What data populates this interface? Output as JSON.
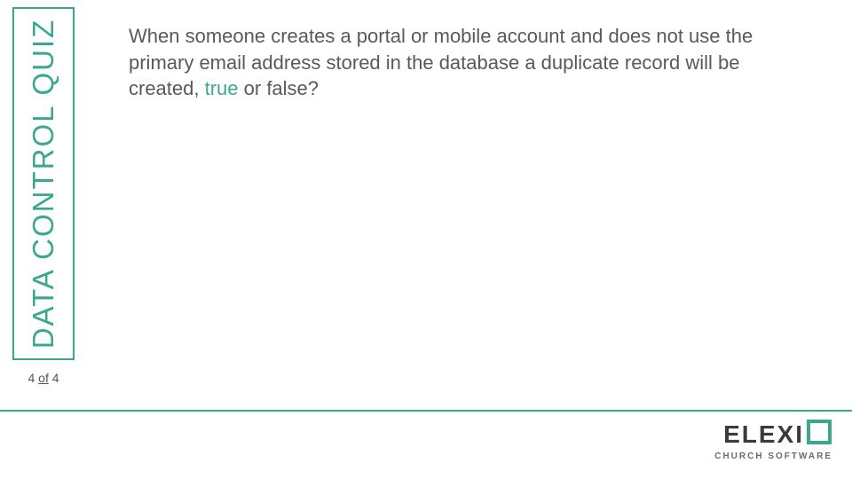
{
  "sidebar": {
    "title": "DATA CONTROL QUIZ"
  },
  "pager": {
    "current": "4",
    "of_word": "of",
    "total": "4"
  },
  "question": {
    "text_before": "When someone creates a portal or mobile account and does not use the primary email address stored in the database a duplicate record will be created, ",
    "answer": "true",
    "text_after": " or false?"
  },
  "brand": {
    "name": "ELEXI",
    "subtitle": "CHURCH SOFTWARE",
    "accent": "#3aa78f"
  }
}
